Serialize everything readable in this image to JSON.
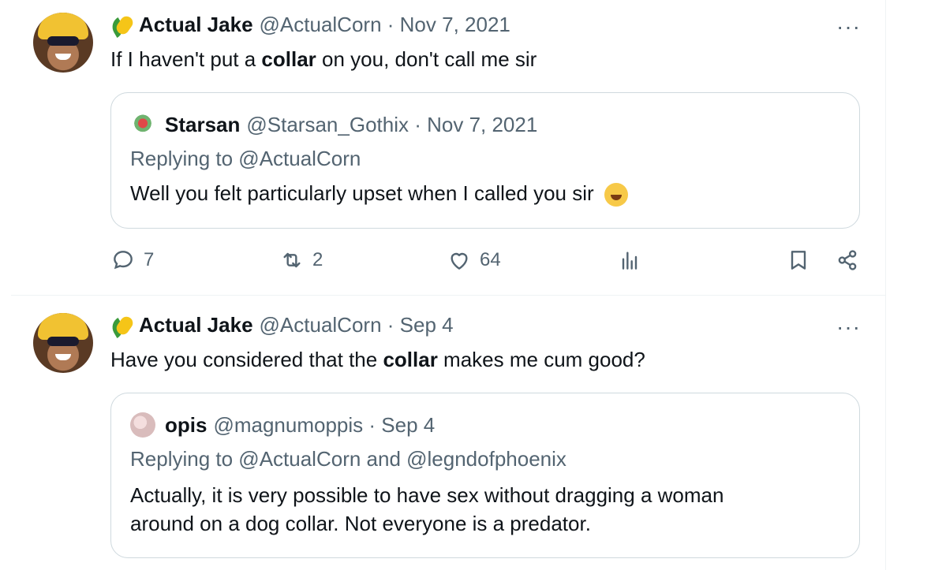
{
  "tweets": [
    {
      "author_name": "Actual Jake",
      "handle": "@ActualCorn",
      "separator": " · ",
      "date": "Nov 7, 2021",
      "text_before": "If I haven't put a ",
      "text_bold": "collar",
      "text_after": " on you, don't call me sir",
      "more_label": "···",
      "quote": {
        "author_name": "Starsan",
        "handle": "@Starsan_Gothix",
        "separator": " · ",
        "date": "Nov 7, 2021",
        "replying": "Replying to @ActualCorn",
        "text_lines": [
          "Well you felt particularly upset when I called you sir"
        ]
      },
      "actions": {
        "replies": "7",
        "retweets": "2",
        "likes": "64"
      }
    },
    {
      "author_name": "Actual Jake",
      "handle": "@ActualCorn",
      "separator": " · ",
      "date": "Sep 4",
      "text_before": "Have you considered that the ",
      "text_bold": "collar",
      "text_after": " makes me cum good?",
      "more_label": "···",
      "quote": {
        "author_name": "opis",
        "handle": "@magnumoppis",
        "separator": " · ",
        "date": "Sep 4",
        "replying": "Replying to @ActualCorn and @legndofphoenix",
        "text_lines": [
          "Actually, it is very possible to have sex without dragging a woman",
          "around on a dog collar. Not everyone is a predator."
        ]
      }
    }
  ],
  "icons": {
    "author_badge": "corn-emoji-icon",
    "laugh": "rolling-laughing-emoji-icon",
    "reply": "reply-icon",
    "retweet": "retweet-icon",
    "like": "heart-icon",
    "views": "analytics-icon",
    "bookmark": "bookmark-icon",
    "share": "share-icon"
  }
}
